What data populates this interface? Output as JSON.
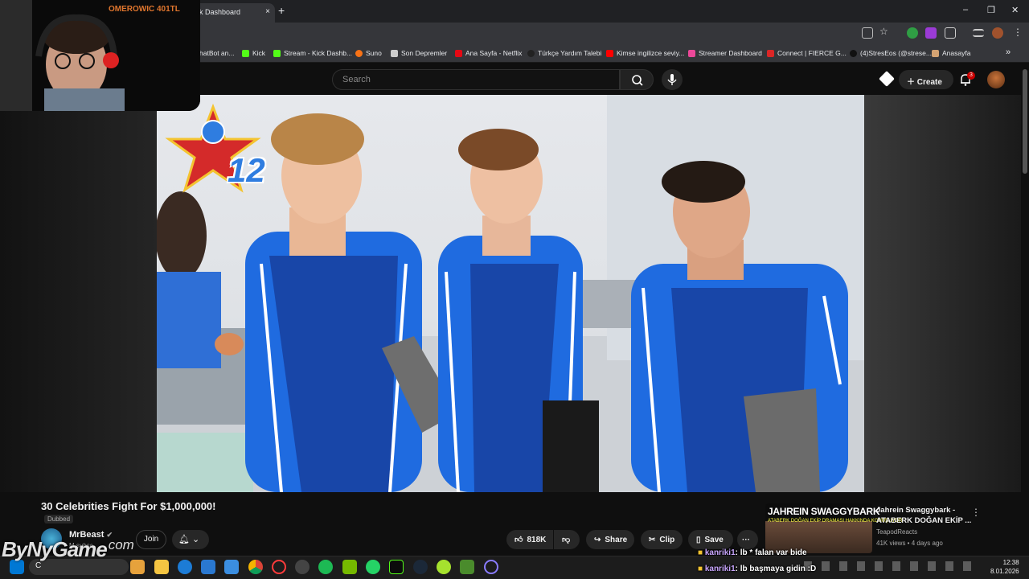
{
  "browser": {
    "tab_title": "k Dashboard",
    "tab_close": "×",
    "new_tab": "+",
    "window_controls": [
      "–",
      "❐",
      "✕"
    ],
    "bookmarks": [
      {
        "label": "hatBot an...",
        "color": "#3b82f6"
      },
      {
        "label": "Kick",
        "color": "#53fc18"
      },
      {
        "label": "Stream - Kick Dashb...",
        "color": "#53fc18"
      },
      {
        "label": "Suno",
        "color": "#f97316"
      },
      {
        "label": "Son Depremler",
        "color": "#cccccc"
      },
      {
        "label": "Ana Sayfa - Netflix",
        "color": "#e50914"
      },
      {
        "label": "Türkçe Yardım Talebi",
        "color": "#222222"
      },
      {
        "label": "Kimse ingilizce seviy...",
        "color": "#ff0000"
      },
      {
        "label": "Streamer Dashboard",
        "color": "#ec4899"
      },
      {
        "label": "Connect | FIERCE G...",
        "color": "#dc2626"
      },
      {
        "label": "(4)StresEos (@strese...",
        "color": "#111111"
      },
      {
        "label": "Anasayfa",
        "color": "#d4a373"
      }
    ],
    "more_bookmarks": "»"
  },
  "webcam": {
    "name": "OMEROWIC 401TL"
  },
  "youtube": {
    "search_placeholder": "Search",
    "create_label": "Create",
    "notification_count": "3"
  },
  "video": {
    "channel_badge_number": "12",
    "title": "30 Celebrities Fight For $1,000,000!",
    "dubbed_label": "Dubbed",
    "channel_name": "MrBeast",
    "subscribers": "M subsc",
    "join_label": "Join",
    "likes": "818K",
    "share_label": "Share",
    "clip_label": "Clip",
    "save_label": "Save",
    "more_label": "···"
  },
  "recommendation": {
    "thumb_text": "JAHREIN SWAGGYBARK",
    "thumb_subtext": "ATABERK DOĞAN EKİP DRAMASI HAKKINDA KONUŞUYOR",
    "title": "Jahrein Swaggybark - ATABERK DOĞAN EKİP ...",
    "channel": "TeapodReacts",
    "meta": "41K views • 4 days ago",
    "menu": "⋮"
  },
  "chat": [
    {
      "user": "kanriki1",
      "message": ": lb * falan var bide"
    },
    {
      "user": "kanriki1",
      "message": ": lb başmaya gidin :D"
    }
  ],
  "watermark": {
    "main": "ByNyGame",
    "suffix": ".com"
  },
  "taskbar": {
    "search_letter": "C",
    "time": "12:38",
    "date": "8.01.2026"
  }
}
